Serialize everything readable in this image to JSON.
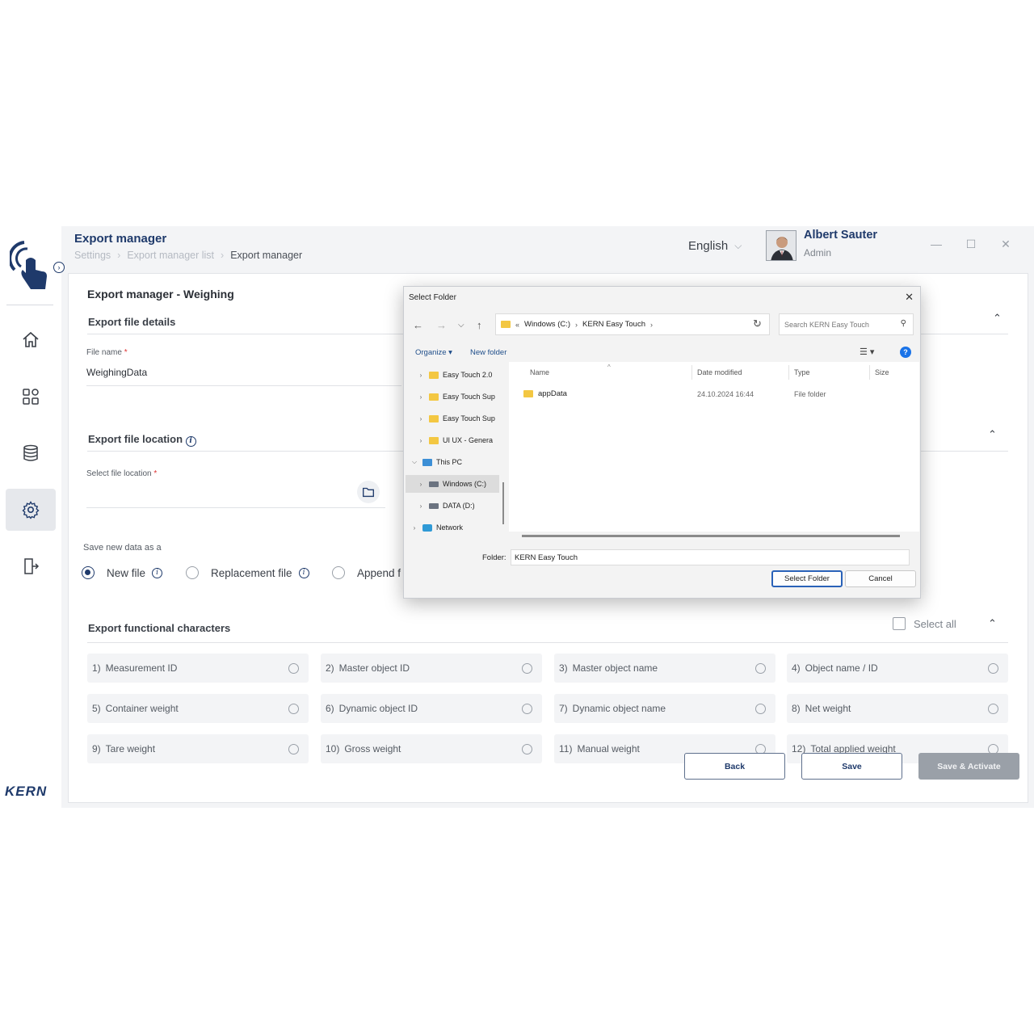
{
  "header": {
    "title": "Export manager",
    "breadcrumb": [
      "Settings",
      "Export manager list",
      "Export manager"
    ],
    "language": "English",
    "user": {
      "name": "Albert Sauter",
      "role": "Admin"
    }
  },
  "sidebar": {
    "items": [
      "home-icon",
      "dashboard-icon",
      "database-icon",
      "settings-icon",
      "logout-icon"
    ],
    "active": "settings-icon",
    "brand": "KERN"
  },
  "main": {
    "title": "Export manager - Weighing",
    "file_details": {
      "heading": "Export file details",
      "file_name_label": "File name",
      "file_name_value": "WeighingData"
    },
    "file_location": {
      "heading": "Export file location",
      "select_label": "Select file location"
    },
    "save_mode": {
      "label": "Save new data as a",
      "options": [
        "New file",
        "Replacement file",
        "Append f"
      ],
      "selected": "New file"
    },
    "functional_characters": {
      "heading": "Export functional characters",
      "select_all": "Select all",
      "items": [
        {
          "num": "1)",
          "label": "Measurement ID"
        },
        {
          "num": "2)",
          "label": "Master object ID"
        },
        {
          "num": "3)",
          "label": "Master object name"
        },
        {
          "num": "4)",
          "label": "Object name / ID"
        },
        {
          "num": "5)",
          "label": "Container weight"
        },
        {
          "num": "6)",
          "label": "Dynamic object ID"
        },
        {
          "num": "7)",
          "label": "Dynamic object name"
        },
        {
          "num": "8)",
          "label": "Net weight"
        },
        {
          "num": "9)",
          "label": "Tare weight"
        },
        {
          "num": "10)",
          "label": "Gross weight"
        },
        {
          "num": "11)",
          "label": "Manual weight"
        },
        {
          "num": "12)",
          "label": "Total applied weight"
        }
      ]
    },
    "buttons": {
      "back": "Back",
      "save": "Save",
      "save_activate": "Save & Activate"
    }
  },
  "dialog": {
    "title": "Select Folder",
    "address": [
      "Windows (C:)",
      "KERN Easy Touch"
    ],
    "search_placeholder": "Search KERN Easy Touch",
    "toolbar": {
      "organize": "Organize ▾",
      "new_folder": "New folder"
    },
    "tree": [
      {
        "label": "Easy Touch 2.0",
        "kind": "folder"
      },
      {
        "label": "Easy Touch Sup",
        "kind": "folder"
      },
      {
        "label": "Easy Touch Sup",
        "kind": "folder"
      },
      {
        "label": "UI UX - Genera",
        "kind": "folder"
      },
      {
        "label": "This PC",
        "kind": "pc"
      },
      {
        "label": "Windows (C:)",
        "kind": "drive"
      },
      {
        "label": "DATA (D:)",
        "kind": "drive"
      },
      {
        "label": "Network",
        "kind": "network"
      }
    ],
    "columns": {
      "name": "Name",
      "date": "Date modified",
      "type": "Type",
      "size": "Size"
    },
    "files": [
      {
        "name": "appData",
        "date": "24.10.2024 16:44",
        "type": "File folder"
      }
    ],
    "folder_label": "Folder:",
    "folder_value": "KERN Easy Touch",
    "buttons": {
      "select": "Select Folder",
      "cancel": "Cancel"
    }
  },
  "colors": {
    "brand_navy": "#1f3a6b",
    "windows_accent": "#2a62b8"
  }
}
